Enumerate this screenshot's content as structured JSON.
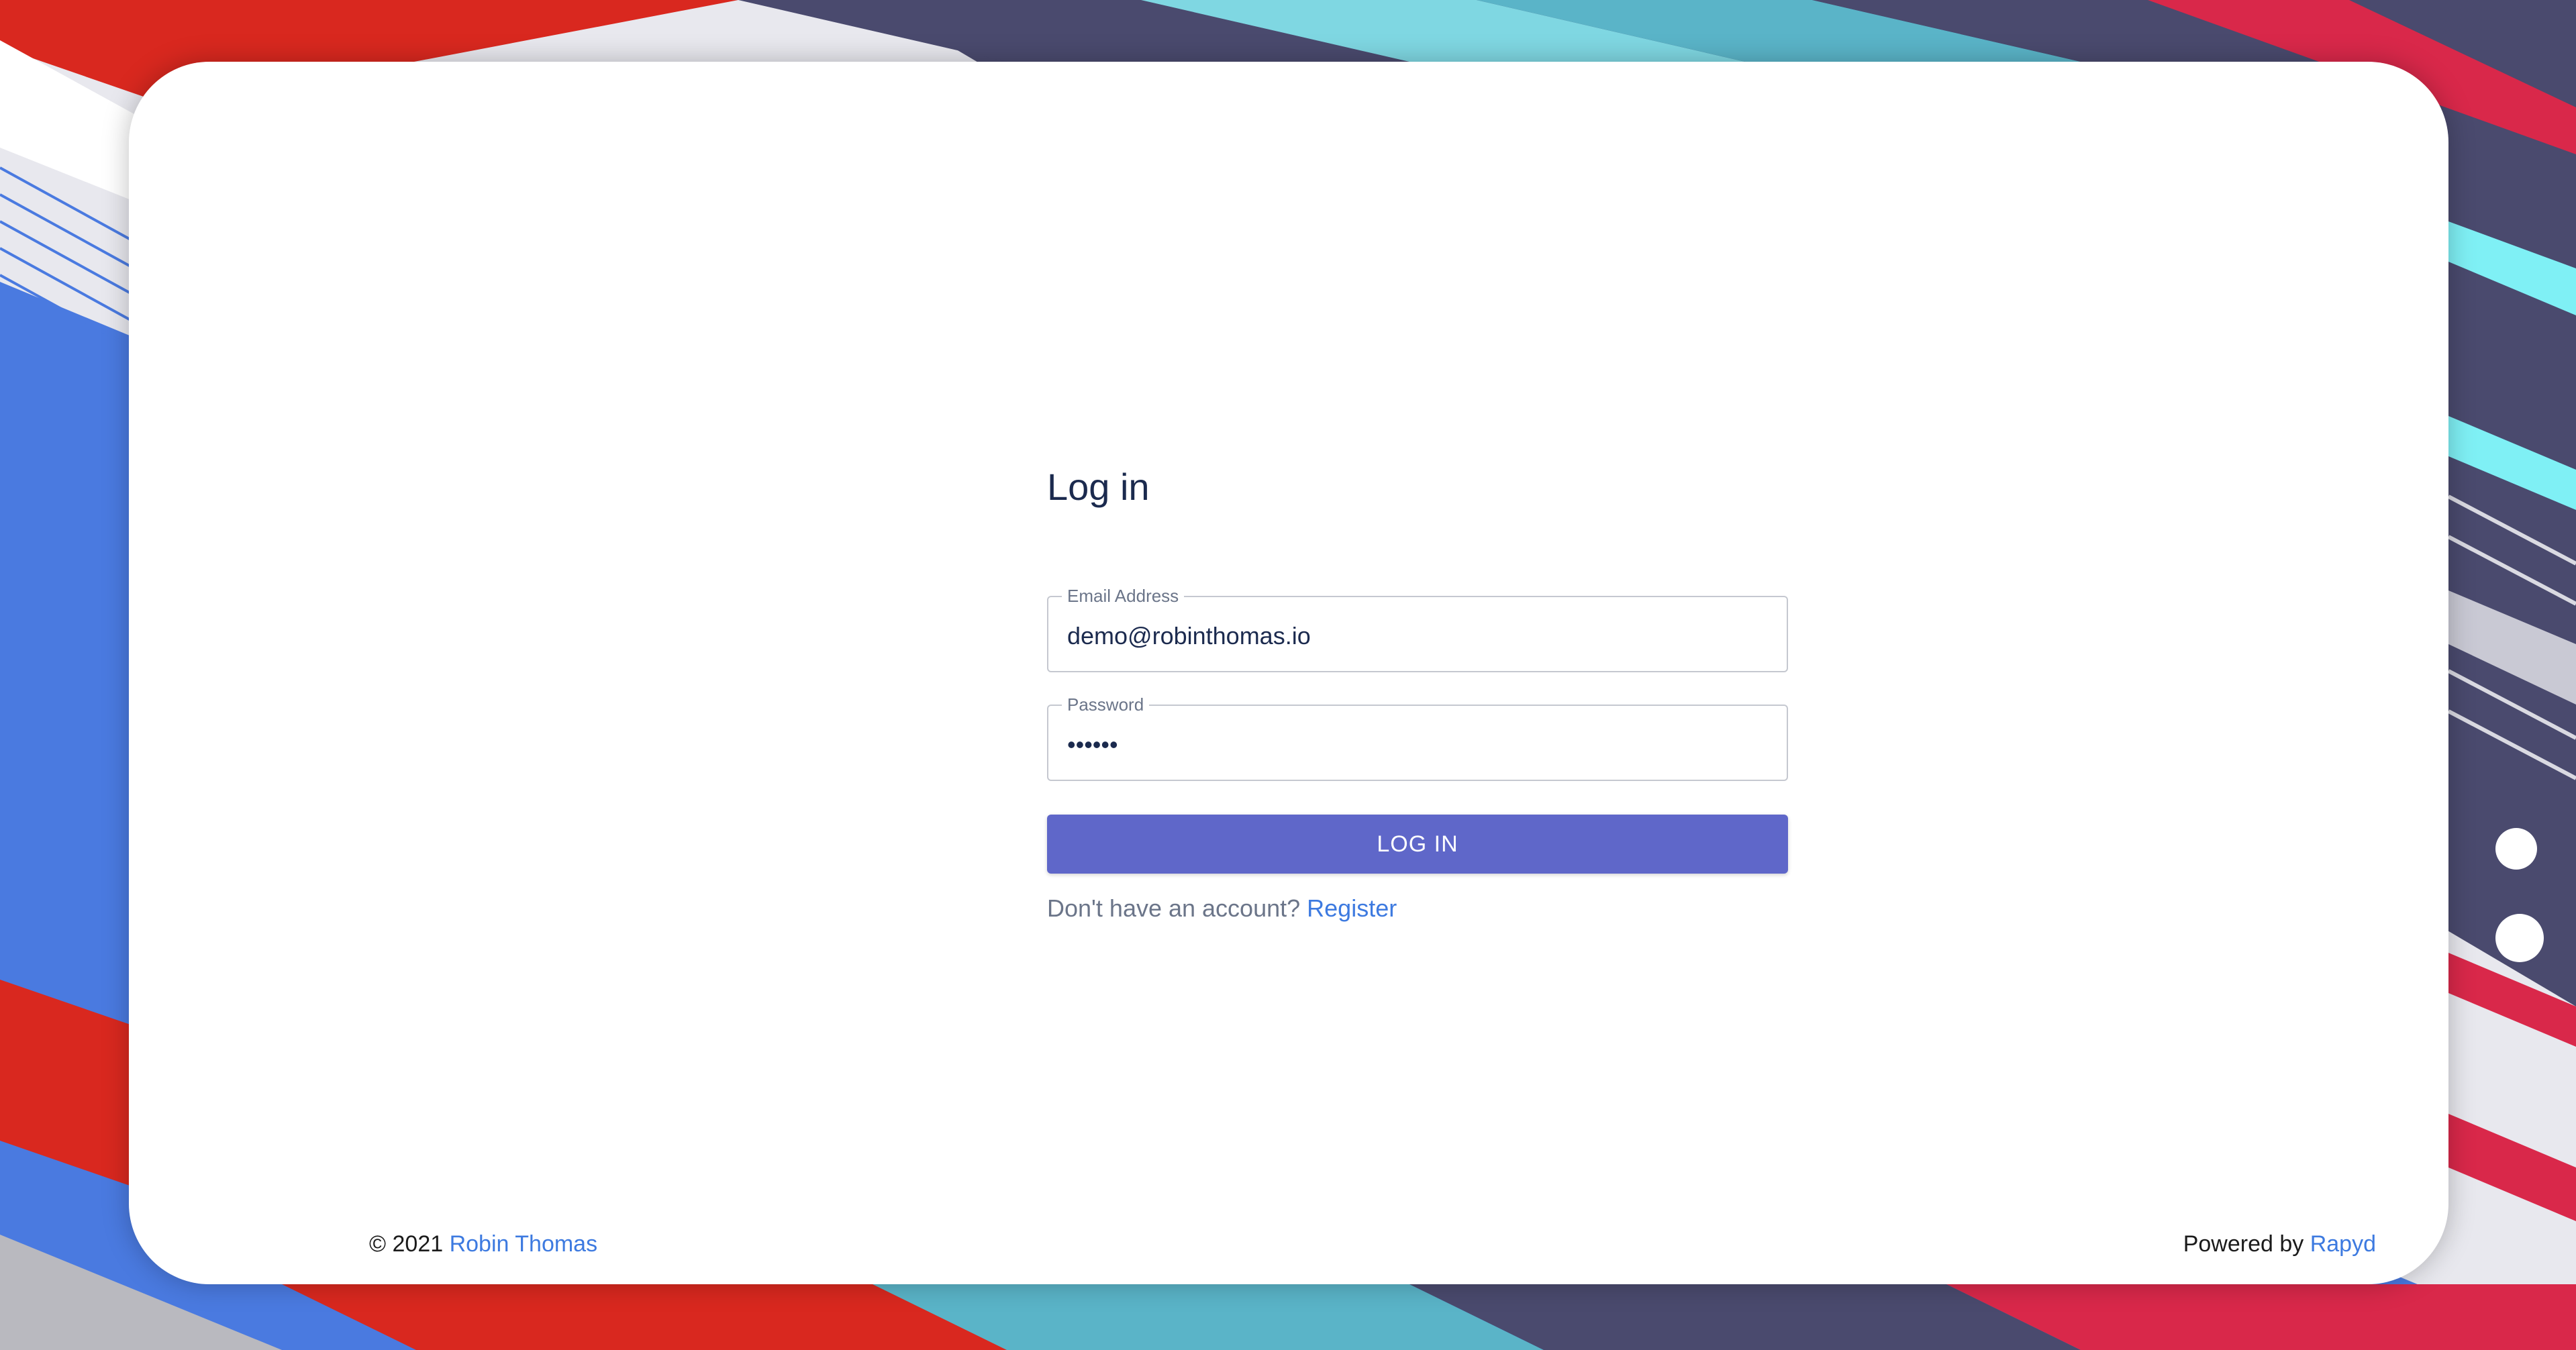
{
  "login": {
    "title": "Log in",
    "email": {
      "label": "Email Address",
      "value": "demo@robinthomas.io"
    },
    "password": {
      "label": "Password",
      "value": "••••••"
    },
    "submit_label": "LOG IN",
    "register_prompt": "Don't have an account?",
    "register_link": "Register"
  },
  "footer": {
    "copyright": "© 2021",
    "author_link": "Robin Thomas",
    "powered_by": "Powered by",
    "powered_link": "Rapyd"
  },
  "colors": {
    "accent": "#5f67c9",
    "link": "#3d7ae0",
    "heading": "#1b2a4e"
  }
}
